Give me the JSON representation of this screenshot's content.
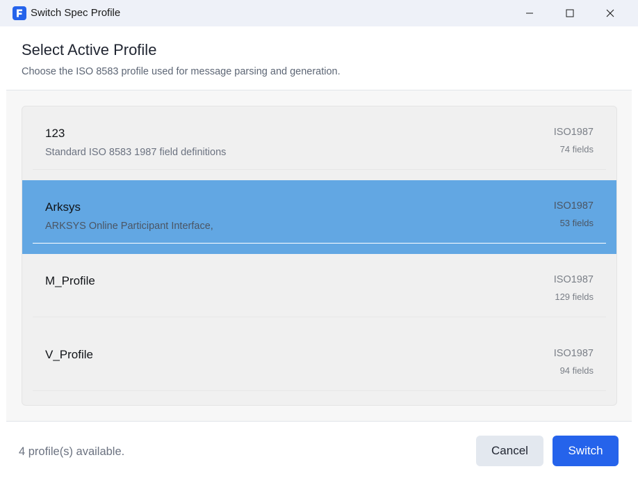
{
  "window": {
    "title": "Switch Spec Profile",
    "app_icon": "app-logo-icon",
    "controls": [
      "minimize-icon",
      "maximize-icon",
      "close-icon"
    ]
  },
  "header": {
    "title": "Select Active Profile",
    "subtitle": "Choose the ISO 8583 profile used for message parsing and generation."
  },
  "profiles": [
    {
      "name": "123",
      "description": "Standard ISO 8583 1987 field definitions",
      "standard": "ISO1987",
      "fields": "74 fields",
      "selected": false
    },
    {
      "name": "Arksys",
      "description": "ARKSYS Online Participant Interface,",
      "standard": "ISO1987",
      "fields": "53 fields",
      "selected": true
    },
    {
      "name": "M_Profile",
      "description": "",
      "standard": "ISO1987",
      "fields": "129 fields",
      "selected": false
    },
    {
      "name": "V_Profile",
      "description": "",
      "standard": "ISO1987",
      "fields": "94 fields",
      "selected": false
    }
  ],
  "footer": {
    "status": "4 profile(s) available.",
    "cancel_label": "Cancel",
    "switch_label": "Switch"
  },
  "colors": {
    "accent": "#2563eb",
    "selected_row": "#62a7e3"
  }
}
